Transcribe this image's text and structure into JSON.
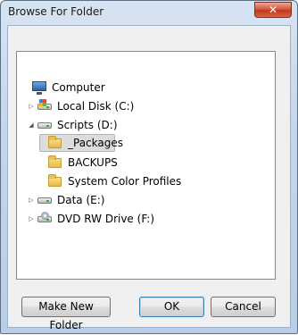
{
  "window": {
    "title": "Browse For Folder",
    "close_glyph": "✕"
  },
  "tree": {
    "items": [
      {
        "label": "Computer",
        "icon": "computer-icon",
        "expander": ""
      },
      {
        "label": "Local Disk (C:)",
        "icon": "windows-drive-icon",
        "expander": "▷"
      },
      {
        "label": "Scripts (D:)",
        "icon": "drive-icon",
        "expander": "◢"
      },
      {
        "label": "_Packages",
        "icon": "folder-icon",
        "expander": "",
        "selected": true
      },
      {
        "label": "BACKUPS",
        "icon": "folder-icon",
        "expander": ""
      },
      {
        "label": "System Color Profiles",
        "icon": "folder-icon",
        "expander": ""
      },
      {
        "label": "Data (E:)",
        "icon": "drive-icon",
        "expander": "▷"
      },
      {
        "label": "DVD RW Drive (F:)",
        "icon": "dvd-drive-icon",
        "expander": "▷"
      }
    ]
  },
  "buttons": {
    "make_new_folder": "Make New Folder",
    "ok": "OK",
    "cancel": "Cancel"
  }
}
